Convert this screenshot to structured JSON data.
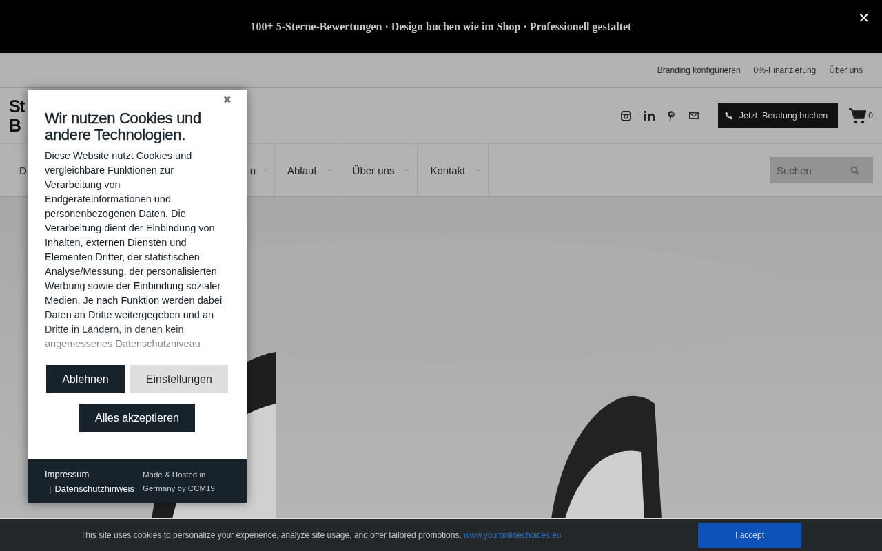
{
  "announcement": {
    "text": "100+ 5-Sterne-Bewertungen · Design buchen wie im Shop · Professionell gestaltet",
    "close": "✕"
  },
  "top_links": [
    "Branding konfigurieren",
    "0%-Finanzierung",
    "Über uns"
  ],
  "logo": {
    "lines": [
      "St",
      "B"
    ]
  },
  "header": {
    "cta": "Jetzt  Beratung buchen",
    "cart_count": "0"
  },
  "nav": {
    "items": [
      "D",
      "n",
      "Ablauf",
      "Über uns",
      "Kontakt"
    ],
    "search": {
      "placeholder": "Suchen"
    }
  },
  "consent_dialog": {
    "close": "✖",
    "title": "Wir nutzen Cookies und andere Technologien.",
    "body": "Diese Website nutzt Cookies und vergleichbare Funktionen zur Verarbeitung von Endgeräteinformationen und personenbezogenen Daten. Die Verarbeitung dient der Einbindung von Inhalten, externen Diensten und Elementen Dritter, der statistischen Analyse/Messung, der personalisierten Werbung sowie der Einbindung sozialer Medien. Je nach Funktion werden dabei Daten an Dritte weitergegeben und an Dritte in Ländern, in denen kein angemessenes Datenschutzniveau",
    "buttons": [
      {
        "label": "Ablehnen",
        "kind": "primary"
      },
      {
        "label": "Einstellungen",
        "kind": "secondary"
      },
      {
        "label": "Alles akzeptieren",
        "kind": "primary"
      }
    ],
    "footer_links": [
      "Impressum",
      "Datenschutzhinweis"
    ],
    "separator": "|",
    "credit": "Made & Hosted in Germany by CCM19"
  },
  "cookie_bar": {
    "text": "This site uses cookies to personalize your experience, analyze site usage, and offer tailored promotions.",
    "link": "www.youronlinechoices.eu",
    "button": "I accept"
  }
}
